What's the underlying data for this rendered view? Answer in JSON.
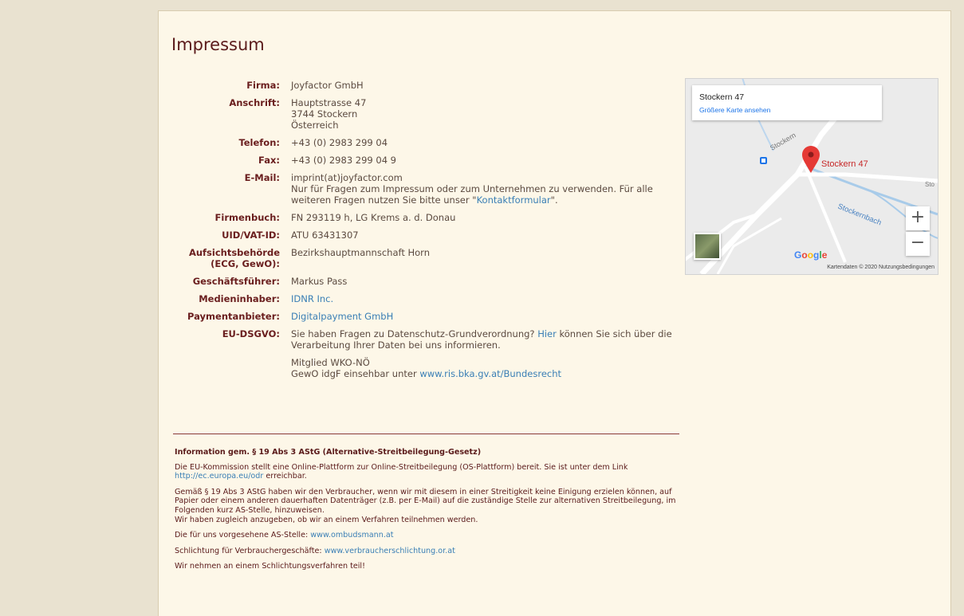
{
  "title": "Impressum",
  "rows": [
    {
      "label": "Firma:",
      "lines": [
        "Joyfactor GmbH"
      ]
    },
    {
      "label": "Anschrift:",
      "lines": [
        "Hauptstrasse 47",
        "3744 Stockern",
        "Österreich"
      ]
    },
    {
      "label": "Telefon:",
      "lines": [
        "+43 (0) 2983 299 04"
      ]
    },
    {
      "label": "Fax:",
      "lines": [
        "+43 (0) 2983 299 04 9"
      ]
    },
    {
      "label": "E-Mail:",
      "lines": [
        "imprint(at)joyfactor.com"
      ],
      "note_pre": "Nur für Fragen zum Impressum oder zum Unternehmen zu verwenden. Für alle weiteren Fragen nutzen Sie bitte unser \"",
      "note_link": "Kontaktformular",
      "note_post": "\"."
    },
    {
      "label": "Firmenbuch:",
      "lines": [
        "FN 293119 h, LG Krems a. d. Donau"
      ]
    },
    {
      "label": "UID/VAT-ID:",
      "lines": [
        "ATU 63431307"
      ]
    },
    {
      "label": "Aufsichtsbehörde (ECG, GewO):",
      "lines": [
        "Bezirkshauptmannschaft Horn"
      ]
    },
    {
      "label": "Geschäftsführer:",
      "lines": [
        "Markus Pass"
      ]
    },
    {
      "label": "Medieninhaber:",
      "link": "IDNR Inc."
    },
    {
      "label": "Paymentanbieter:",
      "link": "Digitalpayment GmbH"
    },
    {
      "label": "EU-DSGVO:",
      "pre": "Sie haben Fragen zu Datenschutz-Grundverordnung? ",
      "link": "Hier",
      "post": " können Sie sich über die Verarbeitung Ihrer Daten bei uns informieren.",
      "extra1": "Mitglied WKO-NÖ",
      "extra2_pre": "GewO idgF einsehbar unter ",
      "extra2_link": "www.ris.bka.gv.at/Bundesrecht"
    }
  ],
  "map": {
    "place": "Stockern 47",
    "bigger_map": "Größere Karte ansehen",
    "marker_label": "Stockern 47",
    "road_label": "Stockern",
    "river_label": "Stockernbach",
    "edge_label": "Sto",
    "zoom_in": "+",
    "zoom_out": "−",
    "google": "Google",
    "attribution": "Kartendaten © 2020   Nutzungsbedingungen"
  },
  "legal": {
    "heading": "Information gem. § 19 Abs 3 AStG (Alternative-Streitbeilegung-Gesetz)",
    "p1": "Die EU-Kommission stellt eine Online-Plattform zur Online-Streitbeilegung (OS-Plattform) bereit. Sie ist unter dem Link",
    "p1_link": "http://ec.europa.eu/odr",
    "p1_post": " erreichbar.",
    "p2": "Gemäß § 19 Abs 3 AStG haben wir den Verbraucher, wenn wir mit diesem in einer Streitigkeit keine Einigung erzielen können, auf Papier oder einem anderen dauerhaften Datenträger (z.B. per E-Mail) auf die zuständige Stelle zur alternativen Streitbeilegung, im Folgenden kurz AS-Stelle, hinzuweisen.",
    "p2b": "Wir haben zugleich anzugeben, ob wir an einem Verfahren teilnehmen werden.",
    "p3": "Die für uns vorgesehene AS-Stelle: ",
    "p3_link": "www.ombudsmann.at",
    "p4": "Schlichtung für Verbrauchergeschäfte: ",
    "p4_link": "www.verbraucherschlichtung.or.at",
    "p5": "Wir nehmen an einem Schlichtungsverfahren teil!"
  },
  "colors": {
    "background": "#e9e2d0",
    "panel": "#fdf7e8",
    "heading": "#5a1a1a",
    "link": "#3a7fb5",
    "marker": "#e53935"
  }
}
